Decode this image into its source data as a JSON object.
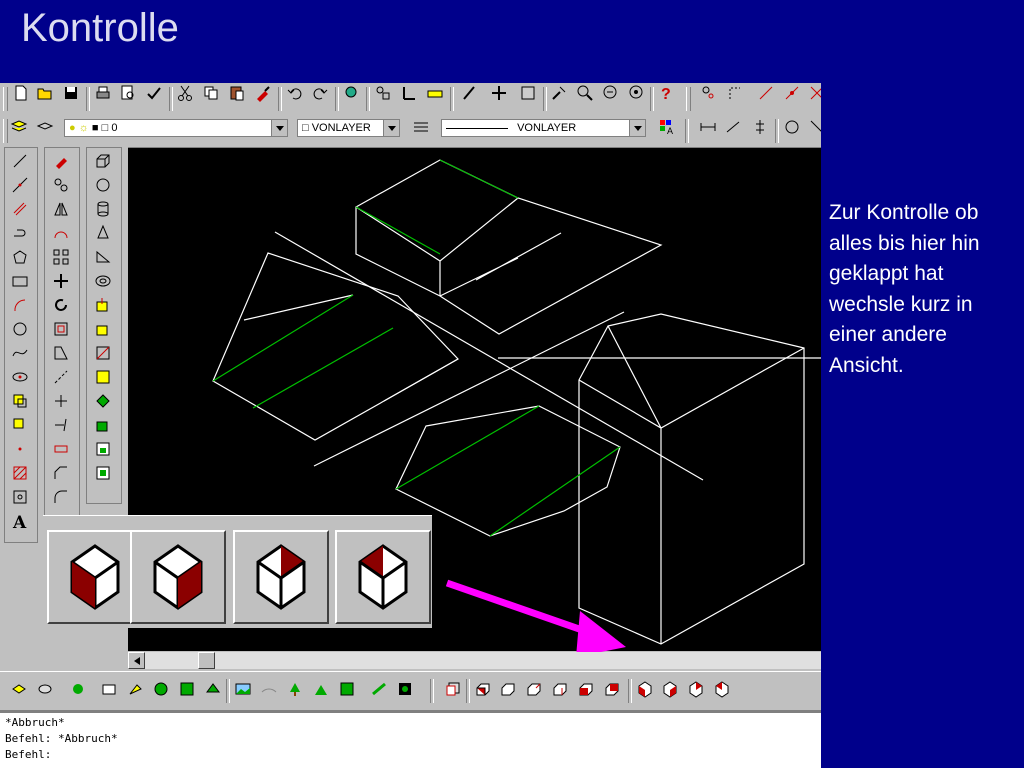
{
  "slide": {
    "title": "Kontrolle",
    "note": "Zur Kontrolle ob alles bis hier hin geklappt hat wechsle kurz in einer andere Ansicht."
  },
  "toolbar": {
    "layer_value": "0",
    "color_value": "VONLAYER",
    "linetype_value": "VONLAYER"
  },
  "shade_buttons": [
    {
      "name": "shade-2d-wireframe"
    },
    {
      "name": "shade-3d-wireframe"
    },
    {
      "name": "shade-hidden"
    },
    {
      "name": "shade-flat"
    }
  ],
  "command_lines": [
    "*Abbruch*",
    "Befehl: *Abbruch*",
    "Befehl:"
  ],
  "colors": {
    "slide_bg": "#00008b",
    "canvas_bg": "#000000",
    "wire": "#ffffff",
    "accent_edge": "#00c000",
    "arrow": "#ff00ff",
    "shade_red": "#8b0000"
  }
}
